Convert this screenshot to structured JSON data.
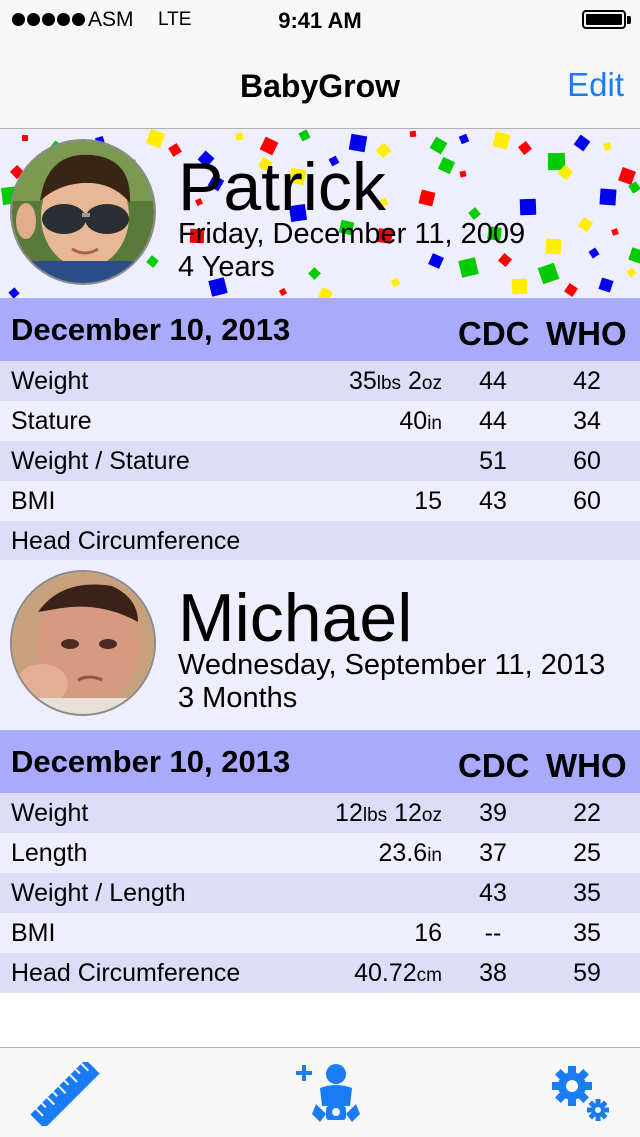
{
  "status_bar": {
    "carrier": "ASM",
    "network": "LTE",
    "time": "9:41 AM"
  },
  "nav": {
    "title": "BabyGrow",
    "edit_label": "Edit"
  },
  "children": [
    {
      "name": "Patrick",
      "dob": "Friday, December 11, 2009",
      "age": "4 Years",
      "table": {
        "date": "December 10, 2013",
        "col_cdc": "CDC",
        "col_who": "WHO",
        "rows": [
          {
            "label": "Weight",
            "value_main": "35",
            "unit1": "lbs",
            "value2": " 2",
            "unit2": "oz",
            "cdc": "44",
            "who": "42"
          },
          {
            "label": "Stature",
            "value_main": "40",
            "unit1": "in",
            "value2": "",
            "unit2": "",
            "cdc": "44",
            "who": "34"
          },
          {
            "label": "Weight / Stature",
            "value_main": "",
            "unit1": "",
            "value2": "",
            "unit2": "",
            "cdc": "51",
            "who": "60"
          },
          {
            "label": "BMI",
            "value_main": "15",
            "unit1": "",
            "value2": "",
            "unit2": "",
            "cdc": "43",
            "who": "60"
          },
          {
            "label": "Head Circumference",
            "value_main": "",
            "unit1": "",
            "value2": "",
            "unit2": "",
            "cdc": "",
            "who": ""
          }
        ]
      }
    },
    {
      "name": "Michael",
      "dob": "Wednesday, September 11, 2013",
      "age": "3 Months",
      "table": {
        "date": "December 10, 2013",
        "col_cdc": "CDC",
        "col_who": "WHO",
        "rows": [
          {
            "label": "Weight",
            "value_main": "12",
            "unit1": "lbs",
            "value2": " 12",
            "unit2": "oz",
            "cdc": "39",
            "who": "22"
          },
          {
            "label": "Length",
            "value_main": "23.6",
            "unit1": "in",
            "value2": "",
            "unit2": "",
            "cdc": "37",
            "who": "25"
          },
          {
            "label": "Weight / Length",
            "value_main": "",
            "unit1": "",
            "value2": "",
            "unit2": "",
            "cdc": "43",
            "who": "35"
          },
          {
            "label": "BMI",
            "value_main": "16",
            "unit1": "",
            "value2": "",
            "unit2": "",
            "cdc": "--",
            "who": "35"
          },
          {
            "label": "Head Circumference",
            "value_main": "40.72",
            "unit1": "cm",
            "value2": "",
            "unit2": "",
            "cdc": "38",
            "who": "59"
          }
        ]
      }
    }
  ],
  "tabbar": {
    "icons": [
      "ruler-icon",
      "add-baby-icon",
      "gears-icon"
    ]
  },
  "colors": {
    "accent": "#1a7cf5",
    "header_row": "#aaaafc",
    "row_a": "#ddddfa",
    "row_b": "#eeeefd"
  }
}
